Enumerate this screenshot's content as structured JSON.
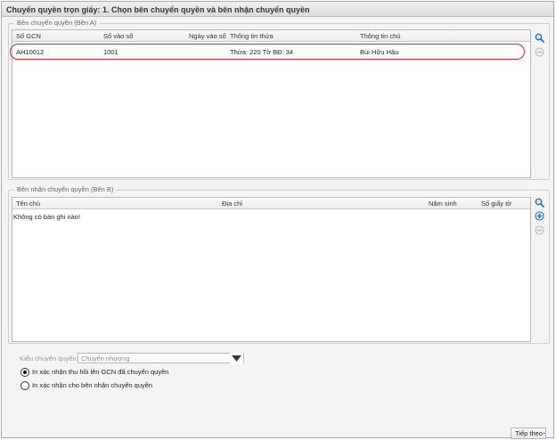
{
  "window": {
    "title": "Chuyển quyền trọn giấy: 1. Chọn bên chuyển quyền và bên nhận chuyển quyền"
  },
  "ben_a": {
    "legend": "Bên chuyển quyền (Bên A)",
    "columns": [
      "Số GCN",
      "Số vào sổ",
      "Ngày vào sổ",
      "Thông tin thửa",
      "Thông tin chủ"
    ],
    "rows": [
      [
        "AH10012",
        "1001",
        "",
        "Thửa: 220 Tờ BĐ: 34",
        "Bùi Hữu Hậu"
      ]
    ]
  },
  "ben_b": {
    "legend": "Bên nhận chuyển quyền (Bên B)",
    "columns": [
      "Tên chủ",
      "Địa chỉ",
      "Năm sinh",
      "Số giấy tờ"
    ],
    "empty_message": "Không có bản ghi nào!"
  },
  "transfer": {
    "type_label": "Kiểu chuyển quyền:",
    "type_value": "Chuyển nhượng",
    "options": [
      {
        "label": "In xác nhận thu hồi lên GCN đã chuyển quyền",
        "checked": true
      },
      {
        "label": "In xác nhận cho bên nhận chuyển quyền",
        "checked": false
      }
    ]
  },
  "footer": {
    "next_label": "Tiếp theo"
  },
  "colors": {
    "accent_blue": "#1f6fcf",
    "highlight_red": "#d9232b",
    "disabled_gray": "#b0b0b0"
  },
  "icons": {
    "search": "search-icon",
    "add": "add-circle-icon",
    "remove": "remove-circle-icon",
    "dropdown": "chevron-down-icon",
    "next": "arrow-right-icon"
  }
}
